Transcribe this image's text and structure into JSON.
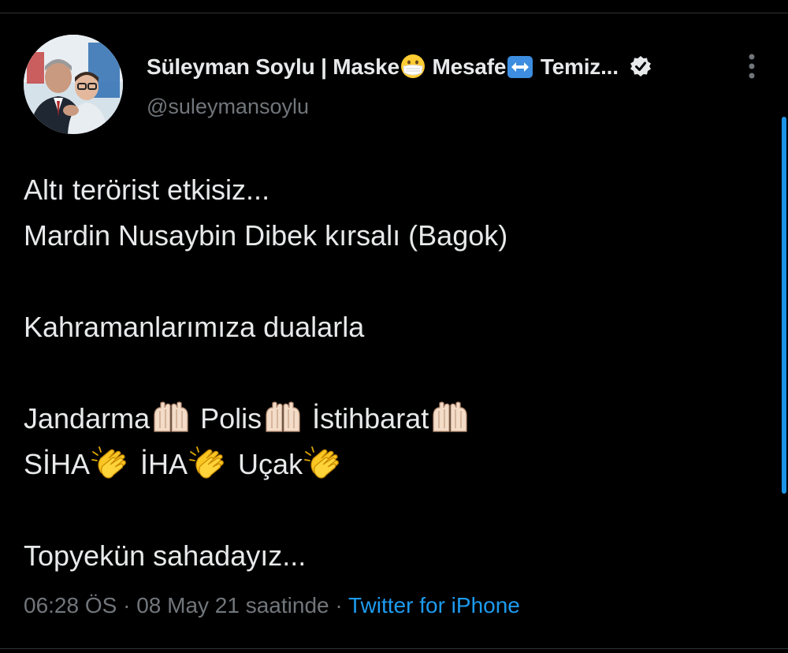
{
  "tweet": {
    "author": {
      "name_part1": "Süleyman Soylu | Maske",
      "name_part2": " Mesafe",
      "name_part3": " Temiz...",
      "handle": "@suleymansoylu",
      "avatar_icon": "profile-photo",
      "verified_icon": "verified-badge-icon",
      "name_emojis": [
        "face-with-medical-mask-emoji",
        "left-right-arrow-emoji"
      ]
    },
    "text": {
      "line1": "Altı terörist etkisiz...",
      "line2": "Mardin Nusaybin Dibek kırsalı (Bagok)",
      "line3": "Kahramanlarımıza dualarla",
      "line4_word1": "Jandarma",
      "line4_word2": " Polis",
      "line4_word3": " İstihbarat",
      "line5_word1": "SİHA",
      "line5_word2": " İHA",
      "line5_word3": " Uçak",
      "line6": "Topyekün sahadayız...",
      "emojis": [
        "folded-hands-emoji",
        "clapping-hands-emoji"
      ]
    },
    "meta": {
      "time": "06:28 ÖS",
      "separator1": " · ",
      "date": "08 May 21 saatinde",
      "separator2": " · ",
      "source": "Twitter for iPhone"
    }
  },
  "colors": {
    "background": "#000000",
    "text": "#e7e9ea",
    "secondary_text": "#71767b",
    "link": "#1d9bf0",
    "divider": "#2f3336"
  }
}
